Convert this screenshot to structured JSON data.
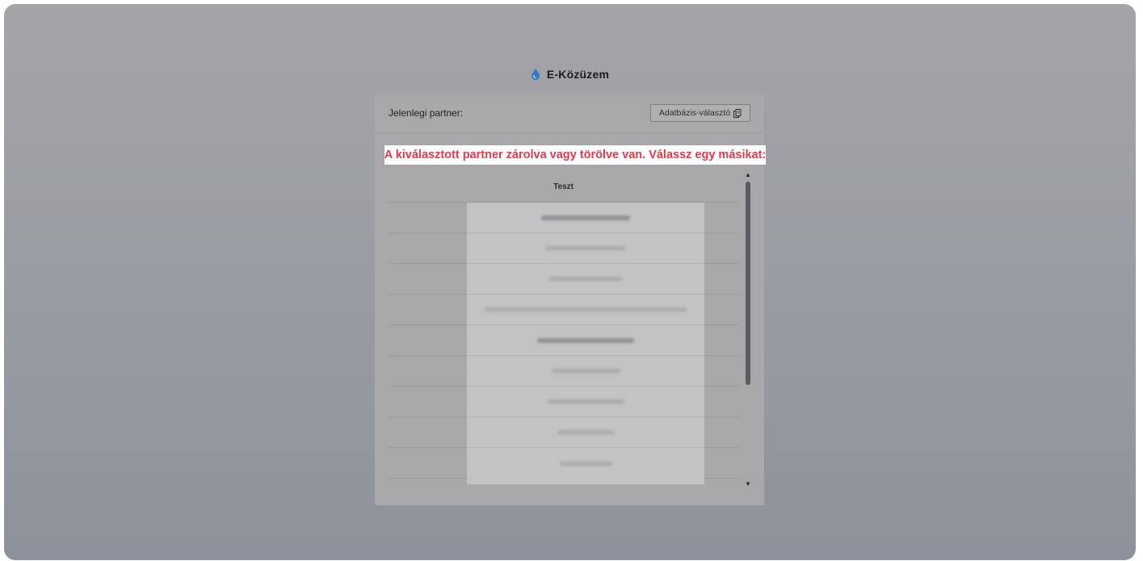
{
  "app": {
    "title": "E-Közüzem"
  },
  "header": {
    "partner_label": "Jelenlegi partner:",
    "db_selector_label": "Adatbázis-választó"
  },
  "warning": {
    "text": "A kiválasztott partner zárolva vagy törölve van. Válassz egy másikat:"
  },
  "list": {
    "header": "Teszt",
    "items": [
      {
        "type": "group",
        "has_delete": false
      },
      {
        "type": "item",
        "has_delete": true
      },
      {
        "type": "item",
        "has_delete": true
      },
      {
        "type": "item",
        "has_delete": true
      },
      {
        "type": "group",
        "has_delete": false
      },
      {
        "type": "item",
        "has_delete": true
      },
      {
        "type": "item",
        "has_delete": true
      },
      {
        "type": "item",
        "has_delete": true
      },
      {
        "type": "item",
        "has_delete": true
      }
    ]
  },
  "icons": {
    "brand": "water-drop-icon",
    "db_selector": "copy-icon",
    "delete": "trash-icon",
    "scroll_up": "scroll-up-arrow-icon",
    "scroll_down": "scroll-down-arrow-icon"
  },
  "colors": {
    "warning_text": "#e8394a",
    "brand_drop": "#2f7fd1",
    "overlay": "#c3c3c5"
  }
}
